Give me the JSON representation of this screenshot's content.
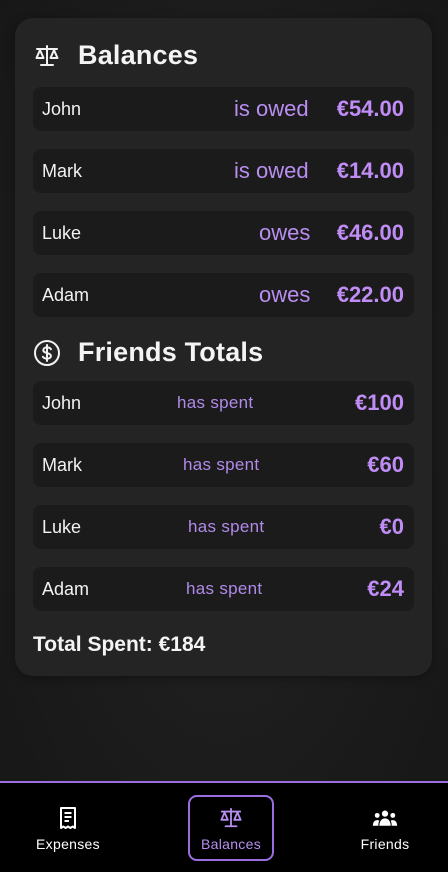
{
  "balances": {
    "title": "Balances",
    "icon": "scale-icon",
    "rows": [
      {
        "name": "John",
        "verb": "is owed",
        "amount": "€54.00"
      },
      {
        "name": "Mark",
        "verb": "is owed",
        "amount": "€14.00"
      },
      {
        "name": "Luke",
        "verb": "owes",
        "amount": "€46.00"
      },
      {
        "name": "Adam",
        "verb": "owes",
        "amount": "€22.00"
      }
    ]
  },
  "friends_totals": {
    "title": "Friends Totals",
    "icon": "dollar-circle-icon",
    "rows": [
      {
        "name": "John",
        "verb": "has spent",
        "amount": "€100"
      },
      {
        "name": "Mark",
        "verb": "has spent",
        "amount": "€60"
      },
      {
        "name": "Luke",
        "verb": "has spent",
        "amount": "€0"
      },
      {
        "name": "Adam",
        "verb": "has spent",
        "amount": "€24"
      }
    ]
  },
  "total_spent": "Total Spent: €184",
  "nav": {
    "items": [
      {
        "label": "Expenses",
        "icon": "receipt-icon",
        "active": false
      },
      {
        "label": "Balances",
        "icon": "scale-icon",
        "active": true
      },
      {
        "label": "Friends",
        "icon": "group-icon",
        "active": false
      }
    ]
  },
  "colors": {
    "accent": "#b98ef0",
    "card": "#242424",
    "row": "#1b1b1b",
    "nav_border": "#9b6ee0"
  }
}
